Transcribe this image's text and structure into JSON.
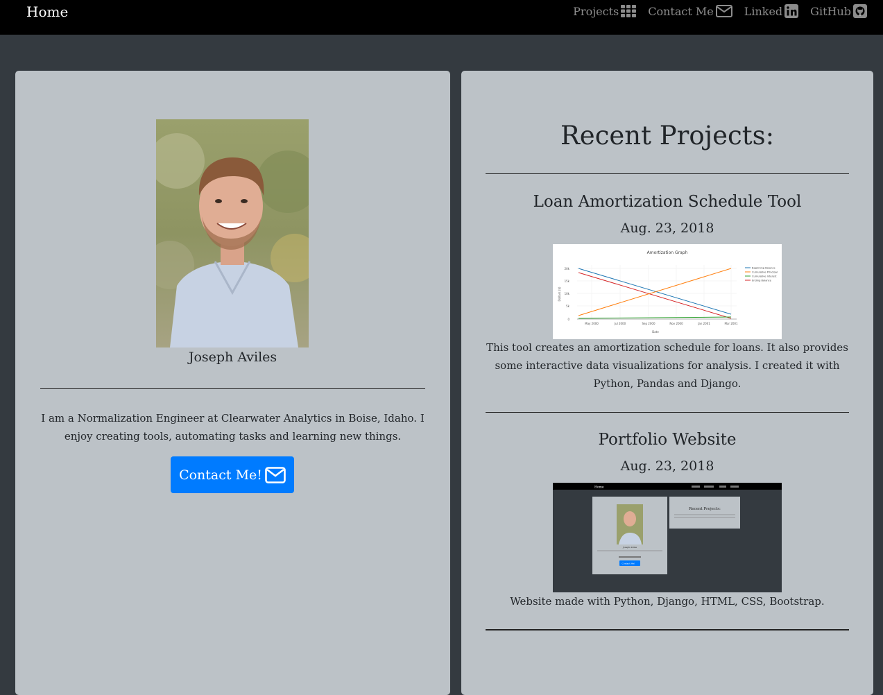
{
  "navbar": {
    "brand": "Home",
    "links": [
      {
        "label": "Projects",
        "icon": "grid-icon"
      },
      {
        "label": "Contact Me",
        "icon": "envelope-icon"
      },
      {
        "label": "Linked",
        "icon": "linkedin-icon"
      },
      {
        "label": "GitHub",
        "icon": "github-icon"
      }
    ]
  },
  "profile": {
    "name": "Joseph Aviles",
    "bio": "I am a Normalization Engineer at Clearwater Analytics in Boise, Idaho. I enjoy creating tools, automating tasks and learning new things.",
    "contact_button": "Contact Me!"
  },
  "projects": {
    "heading": "Recent Projects:",
    "items": [
      {
        "title": "Loan Amortization Schedule Tool",
        "date": "Aug. 23, 2018",
        "description": "This tool creates an amortization schedule for loans. It also provides some interactive data visualizations for analysis. I created it with Python, Pandas and Django.",
        "thumbnail": {
          "title": "Amortization Graph",
          "xlabel": "Date",
          "ylabel": "Dollars ($)",
          "yticks": [
            "0",
            "5k",
            "10k",
            "15k",
            "20k"
          ],
          "xticks": [
            "May 2000",
            "Jul 2000",
            "Sep 2000",
            "Nov 2000",
            "Jan 2001",
            "Mar 2001"
          ],
          "legend": [
            "Beginning Balance",
            "Cumulative Principal",
            "Cumulative Interest",
            "Ending Balance"
          ]
        }
      },
      {
        "title": "Portfolio Website",
        "date": "Aug. 23, 2018",
        "description": "Website made with Python, Django, HTML, CSS, Bootstrap.",
        "thumbnail": {
          "brand": "Home",
          "heading": "Recent Projects:",
          "name": "Joseph Aviles",
          "button": "Contact Me!"
        }
      }
    ]
  },
  "colors": {
    "navbar": "#000000",
    "page_background": "#343a40",
    "card_background": "#bcc2c7",
    "primary": "#007bff"
  }
}
